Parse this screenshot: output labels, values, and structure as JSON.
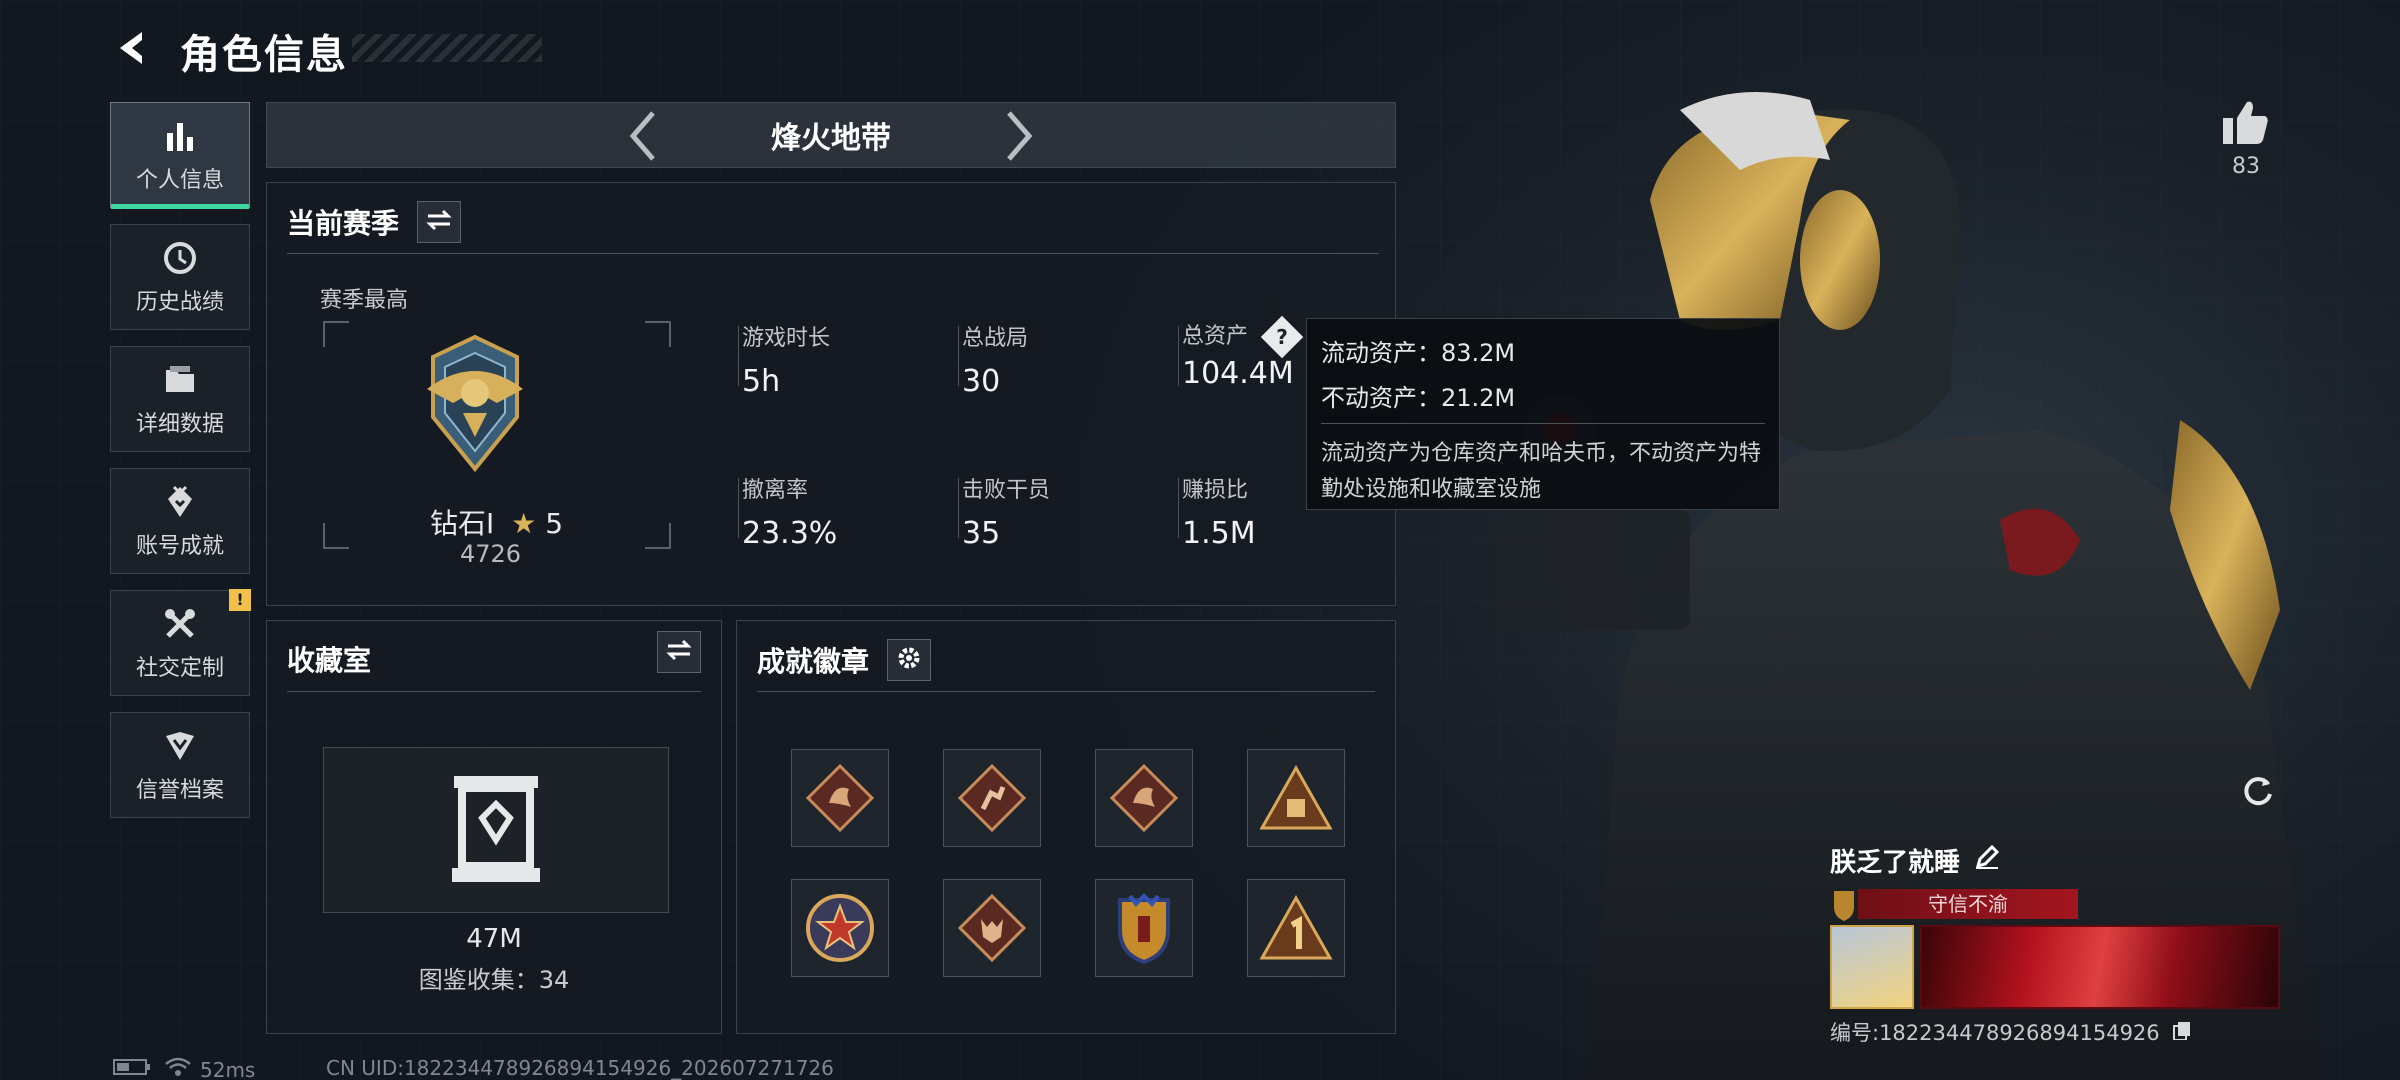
{
  "header": {
    "title": "角色信息"
  },
  "nav": {
    "items": [
      {
        "label": "个人信息",
        "icon": "bar-chart-icon",
        "active": true
      },
      {
        "label": "历史战绩",
        "icon": "history-icon"
      },
      {
        "label": "详细数据",
        "icon": "folder-icon"
      },
      {
        "label": "账号成就",
        "icon": "achievement-icon"
      },
      {
        "label": "社交定制",
        "icon": "tools-icon",
        "badge": "!"
      },
      {
        "label": "信誉档案",
        "icon": "shield-icon"
      }
    ]
  },
  "mode": {
    "title": "烽火地带"
  },
  "season": {
    "title": "当前赛季",
    "best_label": "赛季最高",
    "rank_name": "钻石Ⅰ",
    "rank_stars": "5",
    "rank_score": "4726",
    "stats": [
      {
        "label": "游戏时长",
        "value": "5h"
      },
      {
        "label": "总战局",
        "value": "30"
      },
      {
        "label": "总资产",
        "value": "104.4M"
      },
      {
        "label": "撤离率",
        "value": "23.3%"
      },
      {
        "label": "击败干员",
        "value": "35"
      },
      {
        "label": "赚损比",
        "value": "1.5M"
      }
    ]
  },
  "tooltip": {
    "liquid": "流动资产：83.2M",
    "fixed": "不动资产：21.2M",
    "desc": "流动资产为仓库资产和哈夫币，不动资产为特勤处设施和收藏室设施"
  },
  "collection": {
    "title": "收藏室",
    "value": "47M",
    "count": "图鉴收集：34"
  },
  "achievements": {
    "title": "成就徽章"
  },
  "like": {
    "count": "83"
  },
  "status": {
    "ping": "52ms",
    "uid": "CN UID:18223447892689415492​6_202607271726"
  },
  "player": {
    "name": "朕乏了就睡",
    "title_badge": "守信不渝",
    "id": "编号:18223447892689415492​6"
  },
  "colors": {
    "accent": "#3ed6a0",
    "badge": "#f2c14a",
    "title_badge": "#a31520"
  }
}
